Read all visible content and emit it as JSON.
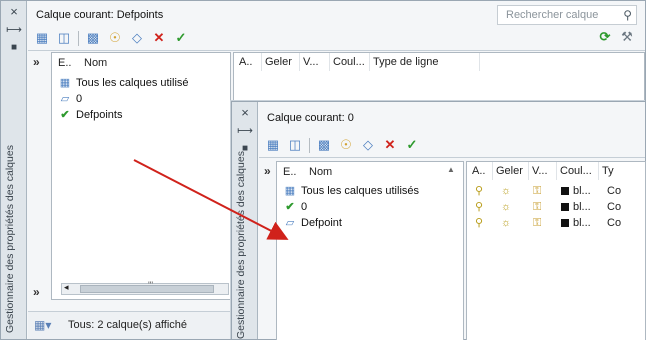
{
  "back": {
    "close_glyph": "×",
    "autohide_glyph": "⟼",
    "props_glyph": "■",
    "side_title": "Gestionnaire des propriétés des calques",
    "current_layer": "Calque courant: Defpoints",
    "search_placeholder": "Rechercher calque",
    "expand_glyph": "»",
    "tree_headers": [
      "E..",
      "Nom"
    ],
    "tree_rows": [
      {
        "label": "Tous les calques utilisé",
        "icon": "filter-icon"
      },
      {
        "label": "0",
        "icon": "layer-icon"
      },
      {
        "label": "Defpoints",
        "icon": "current-check-icon"
      }
    ],
    "grid_headers": [
      "A..",
      "Geler",
      "V...",
      "Coul...",
      "Type de ligne"
    ],
    "status_text": "Tous: 2 calque(s) affiché",
    "scroll_marker": "'''"
  },
  "front": {
    "close_glyph": "×",
    "autohide_glyph": "⟼",
    "props_glyph": "■",
    "side_title": "Gestionnaire des propriétés des calques",
    "current_layer": "Calque courant: 0",
    "expand_glyph": "»",
    "tree_headers": [
      "E..",
      "Nom"
    ],
    "tree_rows": [
      {
        "label": "Tous les calques utilisés",
        "icon": "filter-icon"
      },
      {
        "label": "0",
        "icon": "current-check-icon"
      },
      {
        "label": "Defpoint",
        "icon": "layer-icon"
      }
    ],
    "grid_headers": [
      "A..",
      "Geler",
      "V...",
      "Coul...",
      "Ty"
    ],
    "grid_rows": [
      {
        "color": "bl...",
        "type": "Co"
      },
      {
        "color": "bl...",
        "type": "Co"
      },
      {
        "color": "bl...",
        "type": "Co"
      }
    ]
  },
  "colors": {
    "accent_red": "#d0221b",
    "check_green": "#2e9a2e",
    "bulb_yellow": "#e0c23a"
  }
}
